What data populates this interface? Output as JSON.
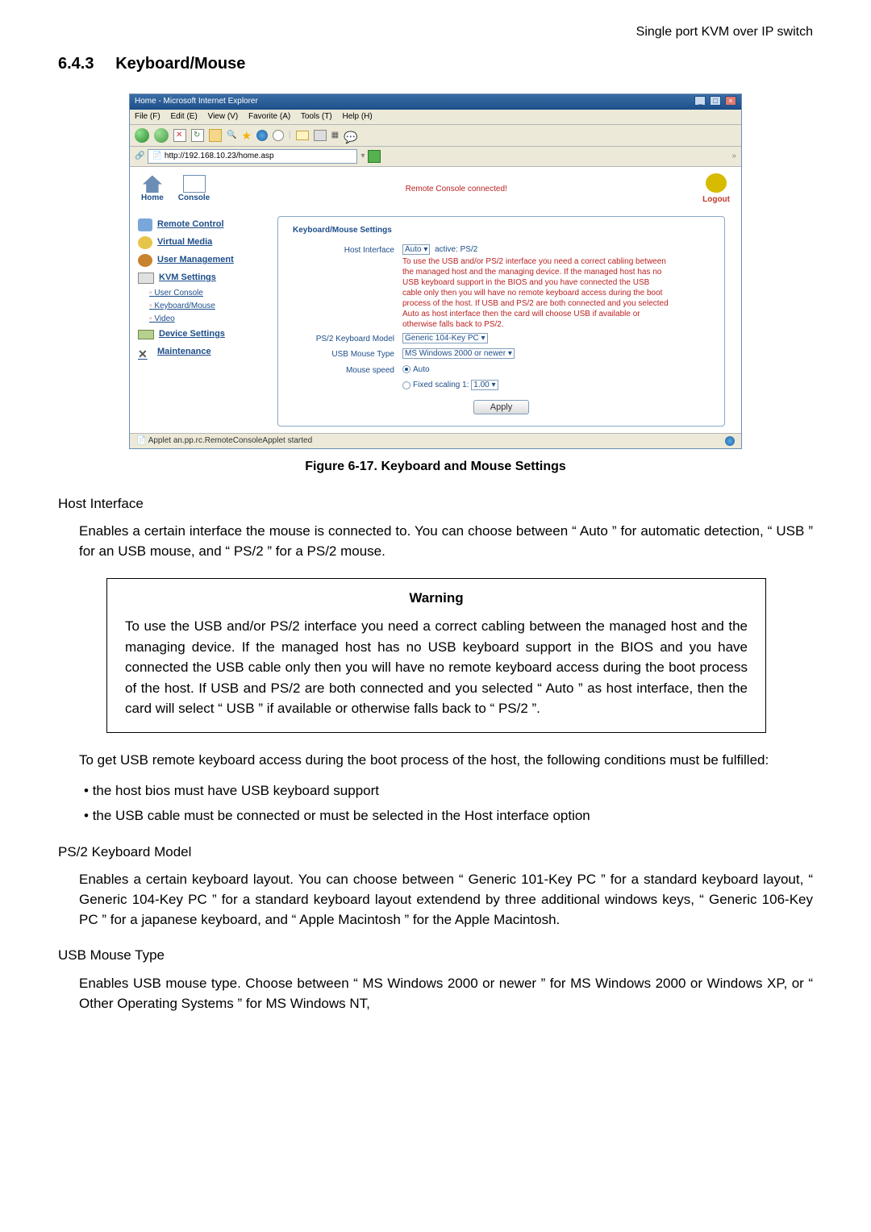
{
  "header_right": "Single port KVM over IP switch",
  "section": {
    "num": "6.4.3",
    "title": "Keyboard/Mouse"
  },
  "browser": {
    "title": "Home - Microsoft Internet Explorer",
    "menus": {
      "file": "File (F)",
      "edit": "Edit (E)",
      "view": "View (V)",
      "favorite": "Favorite (A)",
      "tools": "Tools (T)",
      "help": "Help (H)"
    },
    "address_url": "http://192.168.10.23/home.asp",
    "statusbar_text": "Applet an.pp.rc.RemoteConsoleApplet started"
  },
  "page": {
    "home": "Home",
    "console": "Console",
    "logout": "Logout",
    "status": "Remote Console connected!",
    "nav": {
      "remote": "Remote Control",
      "virtual": "Virtual Media",
      "user": "User Management",
      "kvm": "KVM Settings",
      "sub_user_console": "User Console",
      "sub_kbm": "Keyboard/Mouse",
      "sub_video": "Video",
      "device": "Device Settings",
      "maint": "Maintenance"
    },
    "kbm": {
      "legend": "Keyboard/Mouse Settings",
      "host_iface_label": "Host Interface",
      "host_iface_value": "Auto",
      "host_iface_active": "active: PS/2",
      "host_iface_note": "To use the USB and/or PS/2 interface you need a correct cabling between the managed host and the managing device. If the managed host has no USB keyboard support in the BIOS and you have connected the USB cable only then you will have no remote keyboard access during the boot process of the host. If USB and PS/2 are both connected and you selected Auto as host interface then the card will choose USB if available or otherwise falls back to PS/2.",
      "kb_model_label": "PS/2 Keyboard Model",
      "kb_model_value": "Generic 104-Key PC",
      "usb_mouse_label": "USB Mouse Type",
      "usb_mouse_value": "MS Windows 2000 or newer",
      "mouse_speed_label": "Mouse speed",
      "mouse_speed_auto": "Auto",
      "mouse_speed_fixed": "Fixed scaling 1:",
      "mouse_speed_fixed_val": "1.00",
      "apply": "Apply"
    }
  },
  "figure_caption": "Figure 6-17. Keyboard and Mouse Settings",
  "host_interface": {
    "heading": "Host Interface",
    "para": "Enables a certain interface the mouse is connected to. You can choose between “ Auto ” for automatic detection, “ USB ” for an USB mouse, and “ PS/2 ” for a PS/2 mouse."
  },
  "warning": {
    "title": "Warning",
    "body": "To use the USB and/or PS/2 interface you need a correct cabling between the managed host and the managing device. If the managed host has no USB keyboard support in the BIOS and you have connected the USB cable only then you will have no remote keyboard access during the boot process of the host. If USB and PS/2 are both connected and you selected “ Auto ” as host interface, then the card will select “ USB ” if available or otherwise falls back to “ PS/2 ”."
  },
  "post_warning": {
    "para": "To get USB remote keyboard access during the boot process of the host, the following conditions must be fulfilled:",
    "bullets": [
      "the host bios must have USB keyboard support",
      "the USB cable must be connected or must be selected in the Host interface option"
    ]
  },
  "ps2_model": {
    "heading": "PS/2 Keyboard Model",
    "para": "Enables a certain keyboard layout. You can choose between “ Generic 101-Key PC ” for a standard keyboard layout, “ Generic 104-Key PC ” for a standard keyboard layout extendend by three additional windows keys, “ Generic 106-Key PC ” for a japanese keyboard, and “ Apple Macintosh ” for the Apple Macintosh."
  },
  "usb_mouse": {
    "heading": "USB Mouse Type",
    "para": "Enables USB mouse type. Choose between “ MS Windows 2000 or newer ” for MS Windows 2000 or Windows XP, or “ Other Operating Systems ” for MS Windows NT,"
  }
}
